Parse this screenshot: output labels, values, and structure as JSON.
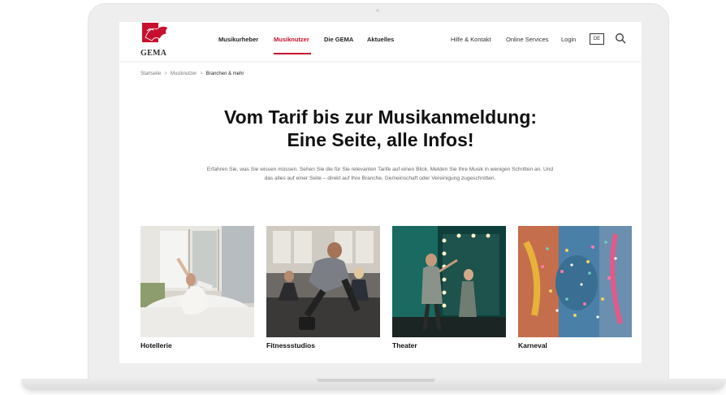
{
  "logo": {
    "text": "GEMA"
  },
  "nav": {
    "items": [
      "Musikurheber",
      "Musiknutzer",
      "Die GEMA",
      "Aktuelles"
    ],
    "active": "Musiknutzer"
  },
  "utility": {
    "help": "Hilfe & Kontakt",
    "online": "Online Services",
    "login": "Login",
    "lang": "DE"
  },
  "breadcrumb": [
    "Startseite",
    "Musiknutzer",
    "Branchen & mehr"
  ],
  "breadcrumb_sep": ">",
  "hero": {
    "line1": "Vom Tarif bis zur Musikanmeldung:",
    "line2": "Eine Seite, alle Infos!",
    "intro": "Erfahren Sie, was Sie wissen müssen. Sehen Sie die für Sie relevanten Tarife auf einen Blick. Melden Sie Ihre Musik in wenigen Schritten an. Und das alles auf einer Seite – direkt auf Ihre Branche, Gemeinschaft oder Vereinigung zugeschnitten."
  },
  "cards": [
    {
      "title": "Hotellerie",
      "image": "hotel-photo"
    },
    {
      "title": "Fitnessstudios",
      "image": "gym-photo"
    },
    {
      "title": "Theater",
      "image": "theater-photo"
    },
    {
      "title": "Karneval",
      "image": "carnival-photo"
    }
  ],
  "colors": {
    "brand_red": "#c8102e"
  }
}
